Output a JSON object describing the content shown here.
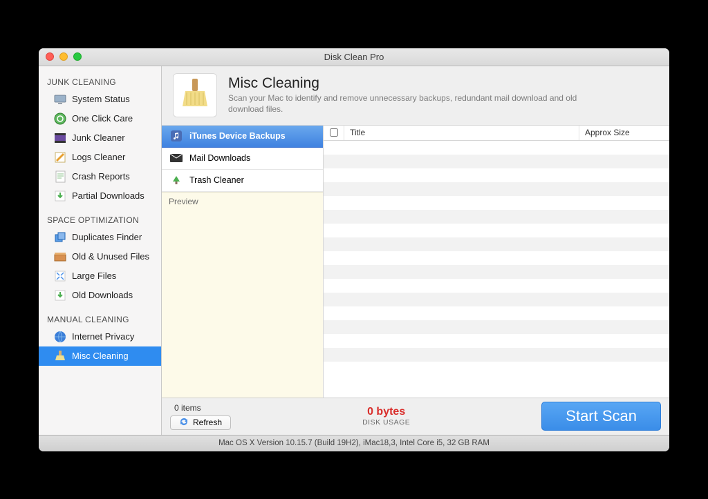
{
  "window": {
    "title": "Disk Clean Pro"
  },
  "sidebar": {
    "sections": [
      {
        "title": "JUNK CLEANING",
        "items": [
          {
            "label": "System Status"
          },
          {
            "label": "One Click Care"
          },
          {
            "label": "Junk Cleaner"
          },
          {
            "label": "Logs Cleaner"
          },
          {
            "label": "Crash Reports"
          },
          {
            "label": "Partial Downloads"
          }
        ]
      },
      {
        "title": "SPACE OPTIMIZATION",
        "items": [
          {
            "label": "Duplicates Finder"
          },
          {
            "label": "Old & Unused Files"
          },
          {
            "label": "Large Files"
          },
          {
            "label": "Old Downloads"
          }
        ]
      },
      {
        "title": "MANUAL CLEANING",
        "items": [
          {
            "label": "Internet Privacy"
          },
          {
            "label": "Misc Cleaning"
          }
        ]
      }
    ]
  },
  "header": {
    "title": "Misc Cleaning",
    "description": "Scan your Mac to identify and remove unnecessary backups, redundant mail download and old download files."
  },
  "categories": [
    {
      "label": "iTunes Device Backups"
    },
    {
      "label": "Mail Downloads"
    },
    {
      "label": "Trash Cleaner"
    }
  ],
  "preview_label": "Preview",
  "table": {
    "columns": {
      "title": "Title",
      "size": "Approx Size"
    }
  },
  "footer": {
    "items_count": "0 items",
    "refresh": "Refresh",
    "bytes": "0 bytes",
    "disk_usage": "DISK USAGE",
    "scan": "Start Scan"
  },
  "statusbar": "Mac OS X Version 10.15.7 (Build 19H2), iMac18,3, Intel Core i5, 32 GB RAM"
}
